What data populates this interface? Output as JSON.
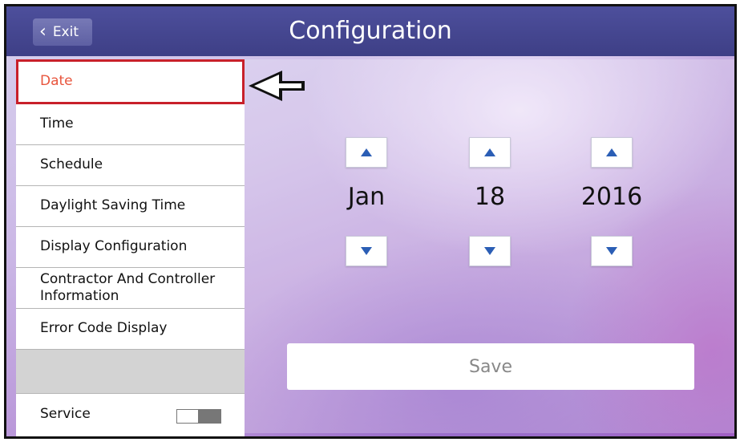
{
  "header": {
    "title": "Configuration",
    "exit_label": "Exit"
  },
  "sidebar": {
    "items": [
      {
        "label": "Date"
      },
      {
        "label": "Time"
      },
      {
        "label": "Schedule"
      },
      {
        "label": "Daylight Saving Time"
      },
      {
        "label": "Display Configuration"
      },
      {
        "label": "Contractor And Controller Information"
      },
      {
        "label": "Error Code Display"
      }
    ],
    "service_label": "Service",
    "service_toggle_state": "off"
  },
  "date": {
    "month": "Jan",
    "day": "18",
    "year": "2016"
  },
  "save_label": "Save",
  "colors": {
    "header": "#45468f",
    "selected_text": "#e8553d",
    "selected_outline": "#c8202a",
    "spinner_arrow": "#2b5eb5"
  },
  "icons": {
    "exit": "chevron-left-icon",
    "up": "triangle-up-icon",
    "down": "triangle-down-icon",
    "pointer": "arrow-left-icon"
  }
}
